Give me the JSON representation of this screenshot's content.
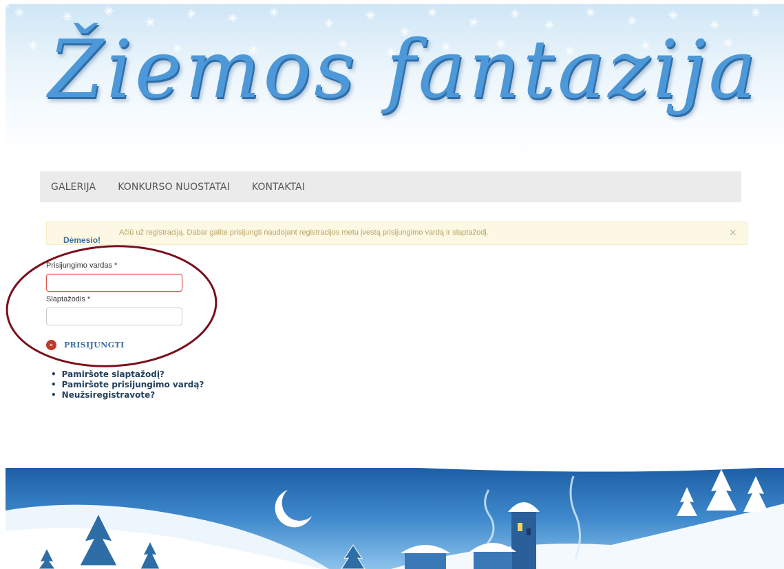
{
  "header": {
    "site_title": "Žiemos fantazija"
  },
  "nav": {
    "items": [
      "GALERIJA",
      "KONKURSO NUOSTATAI",
      "KONTAKTAI"
    ]
  },
  "alert": {
    "heading": "Dėmesio!",
    "message": "Ačiū už registraciją. Dabar galite prisijungti naudojant registracijos metu įvestą prisijungimo vardą ir slaptažodį.",
    "close": "×"
  },
  "form": {
    "username_label": "Prisijungimo vardas *",
    "username_value": "",
    "password_label": "Slaptažodis *",
    "password_value": "",
    "submit_icon": "»",
    "submit_label": "PRISIJUNGTI"
  },
  "links": [
    "Pamiršote slaptažodį?",
    "Pamiršote prisijungimo vardą?",
    "Neužsiregistravote?"
  ],
  "colors": {
    "title_blue": "#4d98d8",
    "alert_bg": "#fcf8e3",
    "annotation": "#7a0f1c",
    "submit_icon": "#c0392b"
  }
}
